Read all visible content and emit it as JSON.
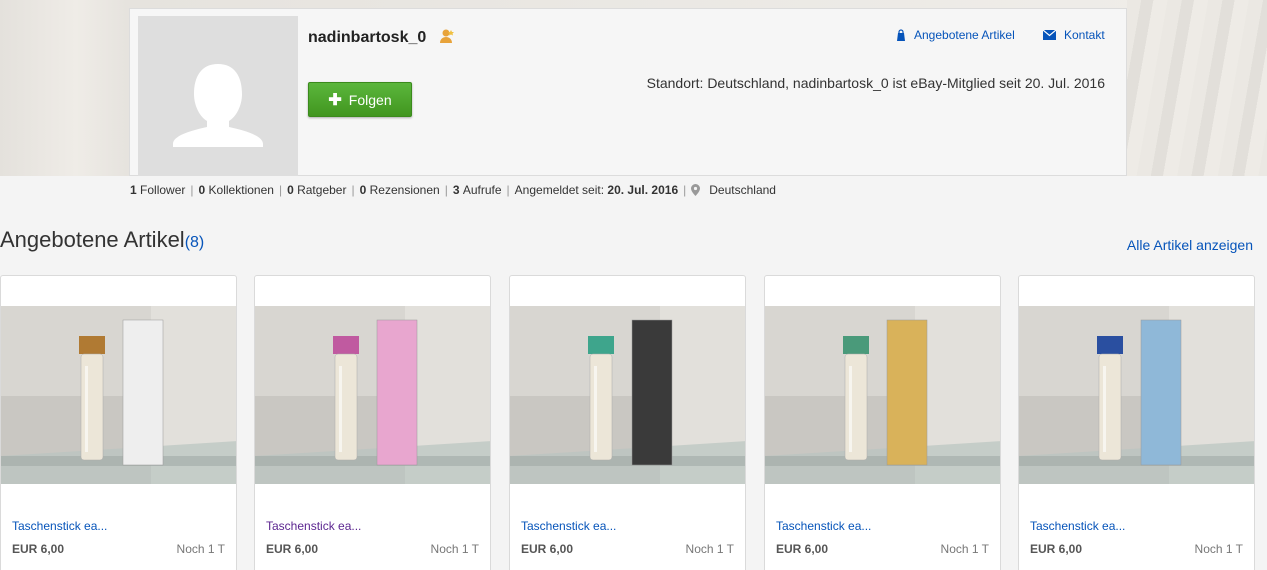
{
  "profile": {
    "username": "nadinbartosk_0",
    "follow_label": "Folgen",
    "offered_link": "Angebotene Artikel",
    "contact_link": "Kontakt",
    "location_text": "Standort: Deutschland, nadinbartosk_0 ist eBay-Mitglied seit 20. Jul. 2016"
  },
  "stats": {
    "followers_count": "1",
    "followers_label": "Follower",
    "collections_count": "0",
    "collections_label": "Kollektionen",
    "guides_count": "0",
    "guides_label": "Ratgeber",
    "reviews_count": "0",
    "reviews_label": "Rezensionen",
    "views_count": "3",
    "views_label": "Aufrufe",
    "member_label": "Angemeldet seit:",
    "member_since": "20. Jul. 2016",
    "location": "Deutschland"
  },
  "section": {
    "title": "Angebotene Artikel",
    "count": "(8)",
    "all_link": "Alle Artikel anzeigen"
  },
  "items": [
    {
      "title": "Taschenstick ea...",
      "price": "EUR 6,00",
      "time": "Noch 1 T",
      "bottle_cap": "#b07a33",
      "box_color": "#eeeeee"
    },
    {
      "title": "Taschenstick ea...",
      "price": "EUR 6,00",
      "time": "Noch 1 T",
      "bottle_cap": "#c05aa0",
      "box_color": "#e8a6cf"
    },
    {
      "title": "Taschenstick ea...",
      "price": "EUR 6,00",
      "time": "Noch 1 T",
      "bottle_cap": "#3ea58c",
      "box_color": "#3a3a3a"
    },
    {
      "title": "Taschenstick ea...",
      "price": "EUR 6,00",
      "time": "Noch 1 T",
      "bottle_cap": "#4a9a7a",
      "box_color": "#d9b25a"
    },
    {
      "title": "Taschenstick ea...",
      "price": "EUR 6,00",
      "time": "Noch 1 T",
      "bottle_cap": "#2a4fa0",
      "box_color": "#8fb8d8"
    }
  ],
  "colors": {
    "link": "#0654ba",
    "visited": "#5c2690",
    "follow_green": "#4aa62a"
  }
}
